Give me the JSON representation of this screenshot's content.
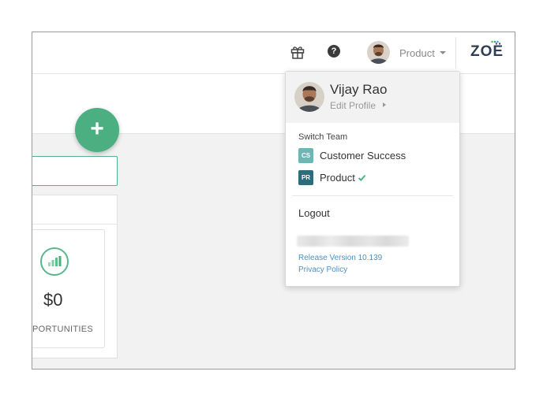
{
  "header": {
    "gift_icon": "gift-icon",
    "help_icon": "help-icon",
    "help_glyph": "?",
    "team_label": "Product",
    "logo": "ZOË",
    "logo_colors": [
      "#66bb6a",
      "#26a69a",
      "#42a5f5"
    ]
  },
  "main": {
    "add_glyph": "+",
    "metric_value": "$0",
    "metric_label": "PORTUNITIES"
  },
  "dropdown": {
    "user_name": "Vijay Rao",
    "edit_profile": "Edit Profile",
    "switch_team_label": "Switch Team",
    "teams": [
      {
        "badge": "CS",
        "name": "Customer Success",
        "color": "#6cb6b4",
        "selected": false
      },
      {
        "badge": "PR",
        "name": "Product",
        "color": "#2e6b7d",
        "selected": true
      }
    ],
    "logout": "Logout",
    "release_version": "Release Version 10.139",
    "privacy_policy": "Privacy Policy"
  },
  "colors": {
    "accent": "#4caf82",
    "link": "#4a90c4",
    "check": "#4caf82"
  }
}
